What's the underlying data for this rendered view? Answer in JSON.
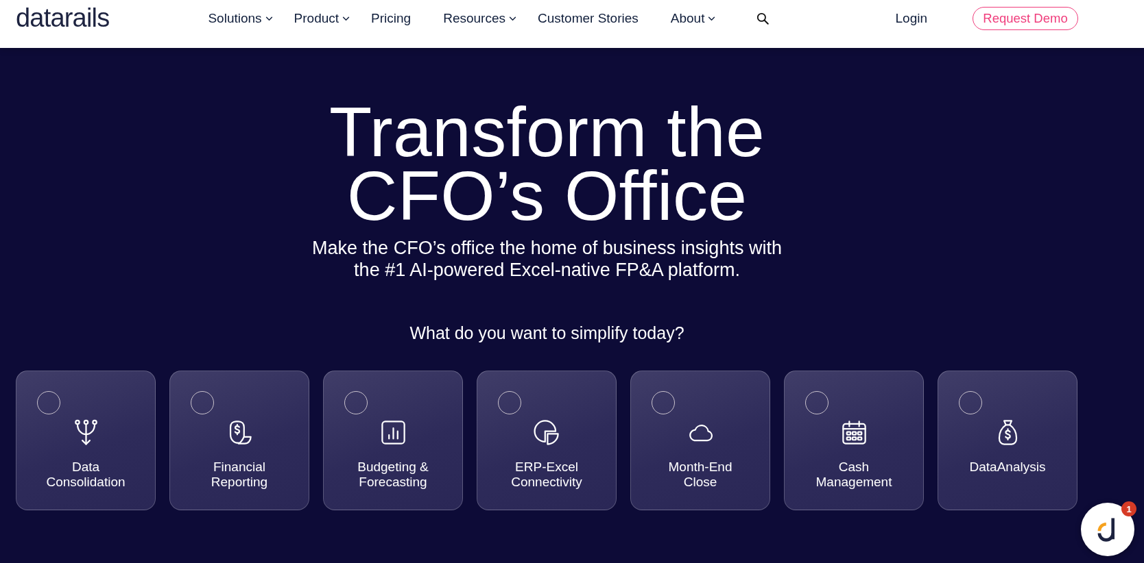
{
  "header": {
    "logo": "datarails",
    "nav": [
      {
        "label": "Solutions",
        "has_menu": true
      },
      {
        "label": "Product",
        "has_menu": true
      },
      {
        "label": "Pricing",
        "has_menu": false
      },
      {
        "label": "Resources",
        "has_menu": true
      },
      {
        "label": "Customer Stories",
        "has_menu": false
      },
      {
        "label": "About",
        "has_menu": true
      }
    ],
    "login": "Login",
    "cta": "Request Demo"
  },
  "hero": {
    "title": "Transform the CFO’s Office",
    "subtitle": "Make the CFO’s office the home of business insights with the #1 AI-powered Excel-native FP&A platform.",
    "question": "What do you want to simplify today?",
    "options": [
      {
        "label": "Data Consolidation",
        "selected": false
      },
      {
        "label": "Financial Reporting",
        "selected": false
      },
      {
        "label": "Budgeting & Forecasting",
        "selected": false
      },
      {
        "label": "ERP-Excel Connectivity",
        "selected": false
      },
      {
        "label": "Month-End Close",
        "selected": false
      },
      {
        "label": "Cash Management",
        "selected": false
      },
      {
        "label": "DataAnalysis",
        "selected": false
      }
    ]
  },
  "chat": {
    "badge": "1"
  }
}
